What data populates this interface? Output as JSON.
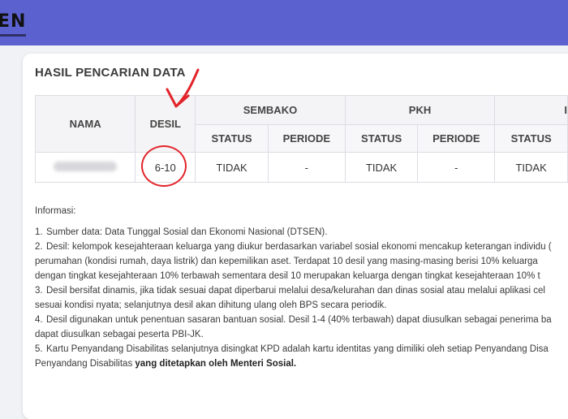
{
  "header": {
    "logo_text": "EN"
  },
  "title": "HASIL PENCARIAN DATA",
  "table": {
    "col_nama": "NAMA",
    "col_desil": "DESIL",
    "groups": [
      "SEMBAKO",
      "PKH",
      "I"
    ],
    "sub_status": "STATUS",
    "sub_periode": "PERIODE",
    "row": {
      "desil": "6-10",
      "sembako_status": "TIDAK",
      "sembako_periode": "-",
      "pkh_status": "TIDAK",
      "pkh_periode": "-",
      "third_status": "TIDAK"
    }
  },
  "info": {
    "title": "Informasi:",
    "items": [
      {
        "num": "1.",
        "lines": [
          "Sumber data: Data Tunggal Sosial dan Ekonomi Nasional (DTSEN)."
        ]
      },
      {
        "num": "2.",
        "lines": [
          "Desil: kelompok kesejahteraan keluarga yang diukur berdasarkan variabel sosial ekonomi mencakup keterangan individu (",
          "perumahan (kondisi rumah, daya listrik) dan kepemilikan aset. Terdapat 10 desil yang masing-masing berisi 10% keluarga",
          "dengan tingkat kesejahteraan 10% terbawah sementara desil 10 merupakan keluarga dengan tingkat kesejahteraan 10% t"
        ]
      },
      {
        "num": "3.",
        "lines": [
          "Desil bersifat dinamis, jika tidak sesuai dapat diperbarui melalui desa/kelurahan dan dinas sosial atau melalui aplikasi cel",
          "sesuai kondisi nyata; selanjutnya desil akan dihitung ulang oleh BPS secara periodik."
        ]
      },
      {
        "num": "4.",
        "lines": [
          "Desil digunakan untuk penentuan sasaran bantuan sosial. Desil 1-4 (40% terbawah) dapat diusulkan sebagai penerima ba",
          "dapat diusulkan sebagai peserta PBI-JK."
        ]
      },
      {
        "num": "5.",
        "lines": [
          "Kartu Penyandang Disabilitas selanjutnya disingkat KPD adalah kartu identitas yang dimiliki oleh setiap Penyandang Disa"
        ],
        "last_line_plain": "Penyandang Disabilitas ",
        "last_line_bold": "yang ditetapkan oleh Menteri Sosial."
      }
    ]
  },
  "colors": {
    "topbar": "#5b62cf",
    "annotation": "#e2242a"
  }
}
